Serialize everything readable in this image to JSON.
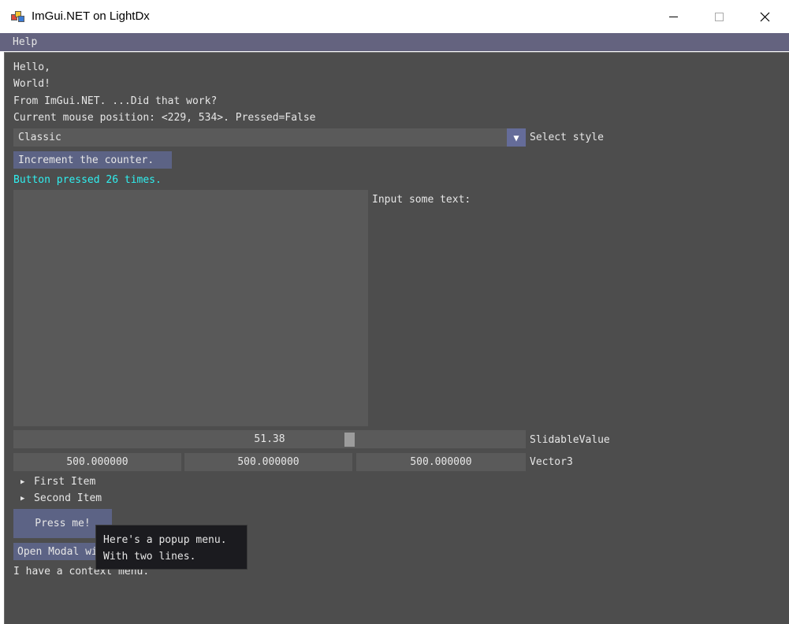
{
  "window": {
    "title": "ImGui.NET on LightDx",
    "controls": {
      "minimize": "minimize-icon",
      "maximize": "maximize-icon",
      "close": "close-icon"
    }
  },
  "menubar": {
    "items": [
      {
        "label": "Help"
      }
    ]
  },
  "main": {
    "lines": {
      "hello": "Hello,",
      "world": "World!",
      "from": "From ImGui.NET. ...Did that work?",
      "mouse": "Current mouse position: <229, 534>. Pressed=False"
    },
    "style_combo": {
      "value": "Classic",
      "label": "Select style",
      "arrow": "▼"
    },
    "increment_button": "Increment the counter.",
    "counter_text": "Button pressed 26 times.",
    "input_label": "Input some text:",
    "slider": {
      "value": "51.38",
      "label": "SlidableValue",
      "fraction": 0.66
    },
    "vector3": {
      "values": [
        "500.000000",
        "500.000000",
        "500.000000"
      ],
      "label": "Vector3"
    },
    "tree": [
      {
        "label": "First Item"
      },
      {
        "label": "Second Item"
      }
    ],
    "press_button": "Press me!",
    "modal_button": "Open Modal window",
    "context_text": "I have a context menu.",
    "popup": {
      "line1": "Here's a popup menu.",
      "line2": "With two lines."
    }
  },
  "colors": {
    "window_bg": "#4d4d4d",
    "menubar_bg": "#64637f",
    "button_bg": "#5c6385",
    "frame_bg": "#5a5a5a",
    "accent_text": "#2ff0f0",
    "popup_bg": "#1b1b1f"
  }
}
